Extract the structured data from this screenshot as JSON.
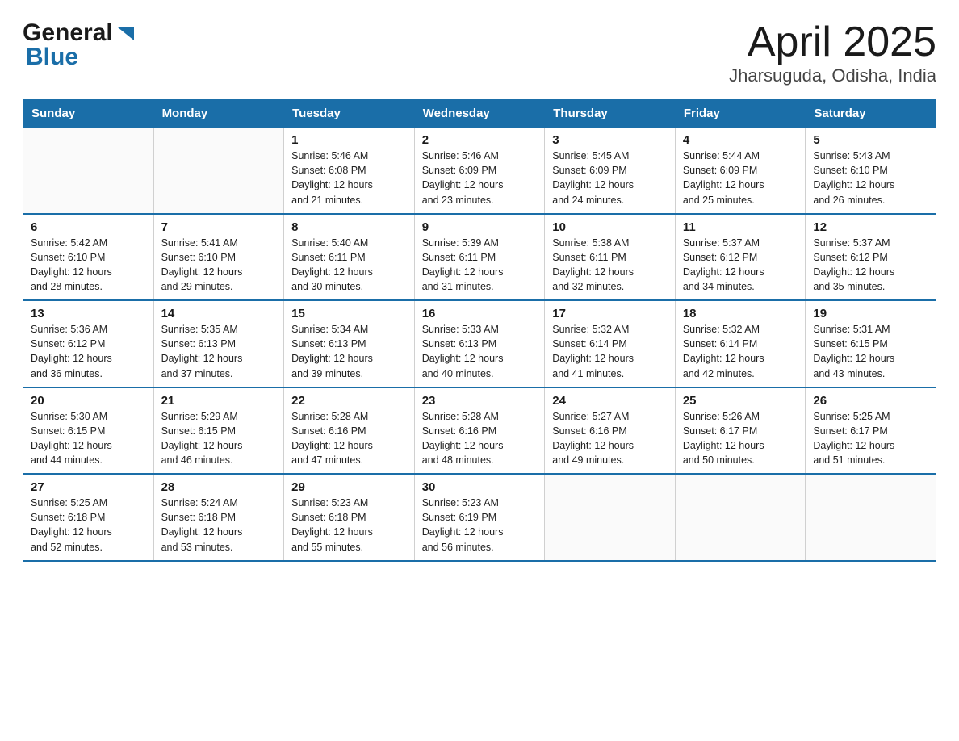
{
  "header": {
    "logo_general": "General",
    "logo_blue": "Blue",
    "title": "April 2025",
    "subtitle": "Jharsuguda, Odisha, India"
  },
  "days_of_week": [
    "Sunday",
    "Monday",
    "Tuesday",
    "Wednesday",
    "Thursday",
    "Friday",
    "Saturday"
  ],
  "weeks": [
    [
      {
        "day": "",
        "info": ""
      },
      {
        "day": "",
        "info": ""
      },
      {
        "day": "1",
        "info": "Sunrise: 5:46 AM\nSunset: 6:08 PM\nDaylight: 12 hours\nand 21 minutes."
      },
      {
        "day": "2",
        "info": "Sunrise: 5:46 AM\nSunset: 6:09 PM\nDaylight: 12 hours\nand 23 minutes."
      },
      {
        "day": "3",
        "info": "Sunrise: 5:45 AM\nSunset: 6:09 PM\nDaylight: 12 hours\nand 24 minutes."
      },
      {
        "day": "4",
        "info": "Sunrise: 5:44 AM\nSunset: 6:09 PM\nDaylight: 12 hours\nand 25 minutes."
      },
      {
        "day": "5",
        "info": "Sunrise: 5:43 AM\nSunset: 6:10 PM\nDaylight: 12 hours\nand 26 minutes."
      }
    ],
    [
      {
        "day": "6",
        "info": "Sunrise: 5:42 AM\nSunset: 6:10 PM\nDaylight: 12 hours\nand 28 minutes."
      },
      {
        "day": "7",
        "info": "Sunrise: 5:41 AM\nSunset: 6:10 PM\nDaylight: 12 hours\nand 29 minutes."
      },
      {
        "day": "8",
        "info": "Sunrise: 5:40 AM\nSunset: 6:11 PM\nDaylight: 12 hours\nand 30 minutes."
      },
      {
        "day": "9",
        "info": "Sunrise: 5:39 AM\nSunset: 6:11 PM\nDaylight: 12 hours\nand 31 minutes."
      },
      {
        "day": "10",
        "info": "Sunrise: 5:38 AM\nSunset: 6:11 PM\nDaylight: 12 hours\nand 32 minutes."
      },
      {
        "day": "11",
        "info": "Sunrise: 5:37 AM\nSunset: 6:12 PM\nDaylight: 12 hours\nand 34 minutes."
      },
      {
        "day": "12",
        "info": "Sunrise: 5:37 AM\nSunset: 6:12 PM\nDaylight: 12 hours\nand 35 minutes."
      }
    ],
    [
      {
        "day": "13",
        "info": "Sunrise: 5:36 AM\nSunset: 6:12 PM\nDaylight: 12 hours\nand 36 minutes."
      },
      {
        "day": "14",
        "info": "Sunrise: 5:35 AM\nSunset: 6:13 PM\nDaylight: 12 hours\nand 37 minutes."
      },
      {
        "day": "15",
        "info": "Sunrise: 5:34 AM\nSunset: 6:13 PM\nDaylight: 12 hours\nand 39 minutes."
      },
      {
        "day": "16",
        "info": "Sunrise: 5:33 AM\nSunset: 6:13 PM\nDaylight: 12 hours\nand 40 minutes."
      },
      {
        "day": "17",
        "info": "Sunrise: 5:32 AM\nSunset: 6:14 PM\nDaylight: 12 hours\nand 41 minutes."
      },
      {
        "day": "18",
        "info": "Sunrise: 5:32 AM\nSunset: 6:14 PM\nDaylight: 12 hours\nand 42 minutes."
      },
      {
        "day": "19",
        "info": "Sunrise: 5:31 AM\nSunset: 6:15 PM\nDaylight: 12 hours\nand 43 minutes."
      }
    ],
    [
      {
        "day": "20",
        "info": "Sunrise: 5:30 AM\nSunset: 6:15 PM\nDaylight: 12 hours\nand 44 minutes."
      },
      {
        "day": "21",
        "info": "Sunrise: 5:29 AM\nSunset: 6:15 PM\nDaylight: 12 hours\nand 46 minutes."
      },
      {
        "day": "22",
        "info": "Sunrise: 5:28 AM\nSunset: 6:16 PM\nDaylight: 12 hours\nand 47 minutes."
      },
      {
        "day": "23",
        "info": "Sunrise: 5:28 AM\nSunset: 6:16 PM\nDaylight: 12 hours\nand 48 minutes."
      },
      {
        "day": "24",
        "info": "Sunrise: 5:27 AM\nSunset: 6:16 PM\nDaylight: 12 hours\nand 49 minutes."
      },
      {
        "day": "25",
        "info": "Sunrise: 5:26 AM\nSunset: 6:17 PM\nDaylight: 12 hours\nand 50 minutes."
      },
      {
        "day": "26",
        "info": "Sunrise: 5:25 AM\nSunset: 6:17 PM\nDaylight: 12 hours\nand 51 minutes."
      }
    ],
    [
      {
        "day": "27",
        "info": "Sunrise: 5:25 AM\nSunset: 6:18 PM\nDaylight: 12 hours\nand 52 minutes."
      },
      {
        "day": "28",
        "info": "Sunrise: 5:24 AM\nSunset: 6:18 PM\nDaylight: 12 hours\nand 53 minutes."
      },
      {
        "day": "29",
        "info": "Sunrise: 5:23 AM\nSunset: 6:18 PM\nDaylight: 12 hours\nand 55 minutes."
      },
      {
        "day": "30",
        "info": "Sunrise: 5:23 AM\nSunset: 6:19 PM\nDaylight: 12 hours\nand 56 minutes."
      },
      {
        "day": "",
        "info": ""
      },
      {
        "day": "",
        "info": ""
      },
      {
        "day": "",
        "info": ""
      }
    ]
  ]
}
